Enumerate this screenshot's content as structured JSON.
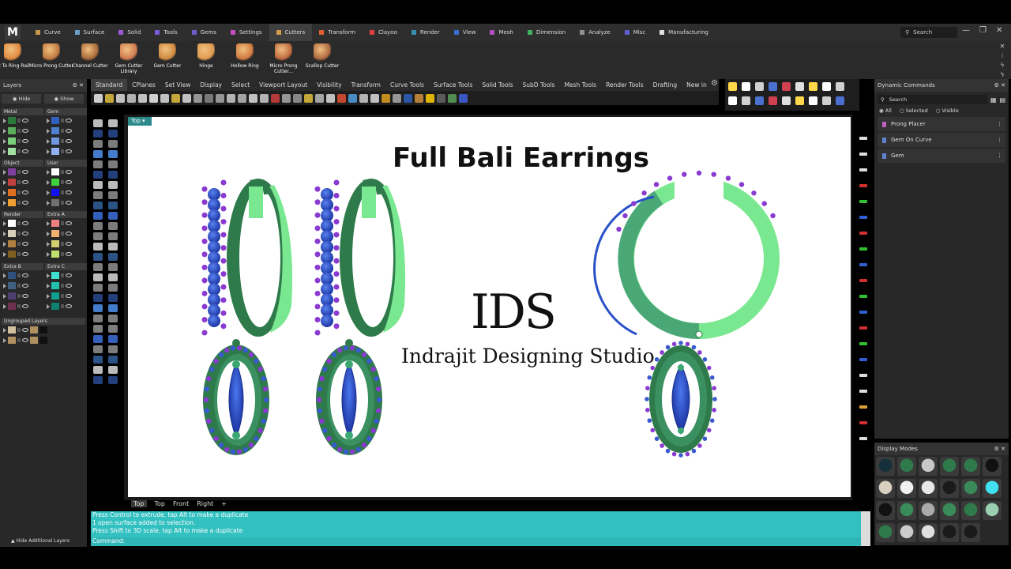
{
  "app": {
    "logo": "M"
  },
  "menu_tabs": [
    {
      "label": "Curve",
      "color": "#c79a4a"
    },
    {
      "label": "Surface",
      "color": "#6aa0c8"
    },
    {
      "label": "Solid",
      "color": "#9b59d6"
    },
    {
      "label": "Tools",
      "color": "#7a5cd6"
    },
    {
      "label": "Gems",
      "color": "#6f5ac8"
    },
    {
      "label": "Settings",
      "color": "#c64ec2"
    },
    {
      "label": "Cutters",
      "color": "#d49a4a",
      "active": true
    },
    {
      "label": "Transform",
      "color": "#e06030"
    },
    {
      "label": "Clayoo",
      "color": "#e04040"
    },
    {
      "label": "Render",
      "color": "#3a8fb0"
    },
    {
      "label": "View",
      "color": "#3a6fd0"
    },
    {
      "label": "Mesh",
      "color": "#b050c0"
    },
    {
      "label": "Dimension",
      "color": "#40b060"
    },
    {
      "label": "Analyze",
      "color": "#909090"
    },
    {
      "label": "Misc",
      "color": "#6060d0"
    },
    {
      "label": "Manufacturing",
      "color": "#e0e0e0"
    }
  ],
  "top_search": "Search",
  "window_controls": [
    "—",
    "❐",
    "✕"
  ],
  "ribbon": [
    {
      "label": "ut To Ring Rail",
      "color": "#e08a40"
    },
    {
      "label": "Micro Prong Cutter",
      "color": "#c07a40"
    },
    {
      "label": "Channel Cutter",
      "color": "#a86a3a"
    },
    {
      "label": "Gem Cutter Library",
      "color": "#d07a50"
    },
    {
      "label": "Gem Cutter",
      "color": "#d08a40"
    },
    {
      "label": "Hinge",
      "color": "#e09a50"
    },
    {
      "label": "Hollow Ring",
      "color": "#d07a40"
    },
    {
      "label": "Micro Prong Cutter...",
      "color": "#c06a40"
    },
    {
      "label": "Scallop Cutter",
      "color": "#b06a40"
    }
  ],
  "layers": {
    "title": "Layers",
    "hide_label": "Hide",
    "show_label": "Show",
    "groups": [
      {
        "name": "Metal",
        "swatches": [
          "#2a7a3a",
          "#5ab05a",
          "#7ad07a",
          "#a0e0a0"
        ]
      },
      {
        "name": "Gem",
        "swatches": [
          "#3060c0",
          "#5080d0",
          "#7098e0",
          "#90b0f0"
        ]
      },
      {
        "name": "Object",
        "swatches": [
          "#8040a0",
          "#c04040",
          "#e07020",
          "#f0a030"
        ]
      },
      {
        "name": "User",
        "swatches": [
          "#ffffff",
          "#40d040",
          "#1010f0",
          "#707070"
        ]
      },
      {
        "name": "Render",
        "swatches": [
          "#ffffff",
          "#d8d0b8",
          "#b08040",
          "#806020"
        ]
      },
      {
        "name": "Extra A",
        "swatches": [
          "#f08080",
          "#f0b070",
          "#d0d070",
          "#c0e070"
        ]
      },
      {
        "name": "Extra B",
        "swatches": [
          "#305080",
          "#406080",
          "#504070",
          "#703050"
        ]
      },
      {
        "name": "Extra C",
        "swatches": [
          "#40e0d0",
          "#20c0b0",
          "#10a090",
          "#108070"
        ]
      },
      {
        "name": "Ungrouped Layers",
        "swatches": [
          "#d0c0a0",
          "#b09060",
          "#101010"
        ]
      }
    ],
    "hide_additional": "Hide Additional Layers"
  },
  "toolbar_tabs": [
    "Standard",
    "CPlanes",
    "Set View",
    "Display",
    "Select",
    "Viewport Layout",
    "Visibility",
    "Transform",
    "Curve Tools",
    "Surface Tools",
    "Solid Tools",
    "SubD Tools",
    "Mesh Tools",
    "Render Tools",
    "Drafting",
    "New in"
  ],
  "viewport": {
    "label": "Top",
    "title": "Full Bali Earrings",
    "brand_main": "IDS",
    "brand_sub": "Indrajit Designing Studio",
    "tabs": [
      "Top",
      "Top",
      "Front",
      "Right",
      "+"
    ]
  },
  "dynamic_commands": {
    "title": "Dynamic Commands",
    "search": "Search",
    "filters": [
      "All",
      "Selected",
      "Visible"
    ],
    "items": [
      {
        "label": "Prong Placer",
        "color": "#c060c0"
      },
      {
        "label": "Gem On Curve",
        "color": "#6080d0"
      },
      {
        "label": "Gem",
        "color": "#6080d0"
      }
    ]
  },
  "display_modes": {
    "title": "Display Modes"
  },
  "command_history": [
    "Press Control to extrude, tap Alt to make a duplicate",
    "1 open surface added to selection.",
    "Press Shift to 3D scale, tap Alt to make a duplicate"
  ],
  "command_prompt": "Command:",
  "colors": {
    "accent": "#33c0c0",
    "metal_dark": "#2e7a4a",
    "metal_light": "#7ae890",
    "gem": "#2a50c8",
    "prong": "#8a3ad0"
  }
}
